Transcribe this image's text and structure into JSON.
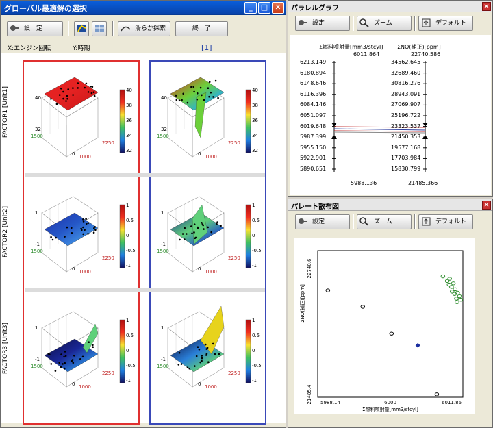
{
  "main_window": {
    "title": "グローバル最適解の選択",
    "window_buttons": [
      "_",
      "□",
      "✕"
    ],
    "toolbar": {
      "settings": "設　定",
      "smooth_search": "滑らか探索",
      "finish": "終　了"
    },
    "axis_info": {
      "x": "X:エンジン回転",
      "y": "Y:時期"
    },
    "page_indicator": "[1]",
    "row_labels": [
      "FACTOR1 [Unit1]",
      "FACTOR2 [Unit2]",
      "FACTOR3 [Unit3]"
    ],
    "plots": [
      {
        "zmax": "40",
        "zmid": "32",
        "ticks": [
          "40",
          "38",
          "36",
          "34",
          "32"
        ],
        "xlow": "1500",
        "x2250": "2250",
        "y0": "0",
        "y1000": "1000"
      },
      {
        "zmax": "40",
        "zmid": "32",
        "ticks": [
          "40",
          "38",
          "36",
          "34",
          "32"
        ],
        "xlow": "1500",
        "x2250": "2250",
        "y0": "0",
        "y1000": "1000"
      },
      {
        "zmax": "1",
        "zmid": "-1",
        "ticks": [
          "1",
          "0.5",
          "0",
          "-0.5",
          "-1"
        ],
        "xlow": "1500",
        "x2250": "2250",
        "y0": "0",
        "y1000": "1000"
      },
      {
        "zmax": "1",
        "zmid": "-1",
        "ticks": [
          "1",
          "0.5",
          "0",
          "-0.5",
          "-1"
        ],
        "xlow": "1500",
        "x2250": "2250",
        "y0": "0",
        "y1000": "1000"
      },
      {
        "zmax": "1",
        "zmid": "-1",
        "ticks": [
          "1",
          "0.5",
          "0",
          "-0.5",
          "-1"
        ],
        "xlow": "1500",
        "x2250": "2250",
        "y0": "0",
        "y1000": "1000"
      },
      {
        "zmax": "1",
        "zmid": "-1",
        "ticks": [
          "1",
          "0.5",
          "0",
          "-0.5",
          "-1"
        ],
        "xlow": "1500",
        "x2250": "2250",
        "y0": "0",
        "y1000": "1000"
      }
    ]
  },
  "parallel_window": {
    "title": "パラレルグラフ",
    "toolbar": {
      "settings": "設定",
      "zoom": "ズーム",
      "default": "デフォルト"
    },
    "axis1": {
      "label": "Σ燃料噴射量[mm3/stcyl]",
      "top": "6011.864",
      "values": [
        "6213.149",
        "6180.894",
        "6148.646",
        "6116.396",
        "6084.146",
        "6051.097",
        "6019.648",
        "5987.399",
        "5955.150",
        "5922.901",
        "5890.651"
      ],
      "bottom": "5988.136"
    },
    "axis2": {
      "label": "ΣNO(補正)[ppm]",
      "top": "22740.586",
      "values": [
        "34562.645",
        "32689.460",
        "30816.276",
        "28943.091",
        "27069.907",
        "25196.722",
        "23323.537",
        "21450.353",
        "19577.168",
        "17703.984",
        "15830.799"
      ],
      "bottom": "21485.366"
    }
  },
  "scatter_window": {
    "title": "パレート散布図",
    "toolbar": {
      "settings": "設定",
      "zoom": "ズーム",
      "default": "デフォルト"
    },
    "chart_data": {
      "type": "scatter",
      "xlabel": "Σ燃料噴射量[mm3/stcyl]",
      "ylabel": "ΣNO(補正)[ppm]",
      "x_ticks": [
        "5988.14",
        "6000",
        "6011.86"
      ],
      "y_ticks": [
        "22740.6",
        "21485.4"
      ],
      "xlim": [
        5988.14,
        6011.86
      ],
      "ylim": [
        21485.4,
        22740.6
      ],
      "series": [
        {
          "color": "#2a8a2a",
          "marker": "circle",
          "x": [
            6008.6,
            6009.3,
            6009.7,
            6009.6,
            6010.0,
            6010.3,
            6010.6,
            6010.1,
            6010.5,
            6011.0,
            6011.3,
            6010.8,
            6011.5,
            6010.9
          ],
          "y": [
            22520,
            22480,
            22500,
            22450,
            22430,
            22460,
            22410,
            22390,
            22370,
            22380,
            22350,
            22330,
            22320,
            22300
          ]
        },
        {
          "color": "#000000",
          "marker": "circle",
          "x": [
            5989.8,
            5995.5,
            6000.2,
            6007.6
          ],
          "y": [
            22400,
            22260,
            22030,
            21510
          ]
        },
        {
          "color": "#1c2fa0",
          "marker": "diamond",
          "x": [
            6004.5
          ],
          "y": [
            21930
          ]
        }
      ]
    }
  }
}
